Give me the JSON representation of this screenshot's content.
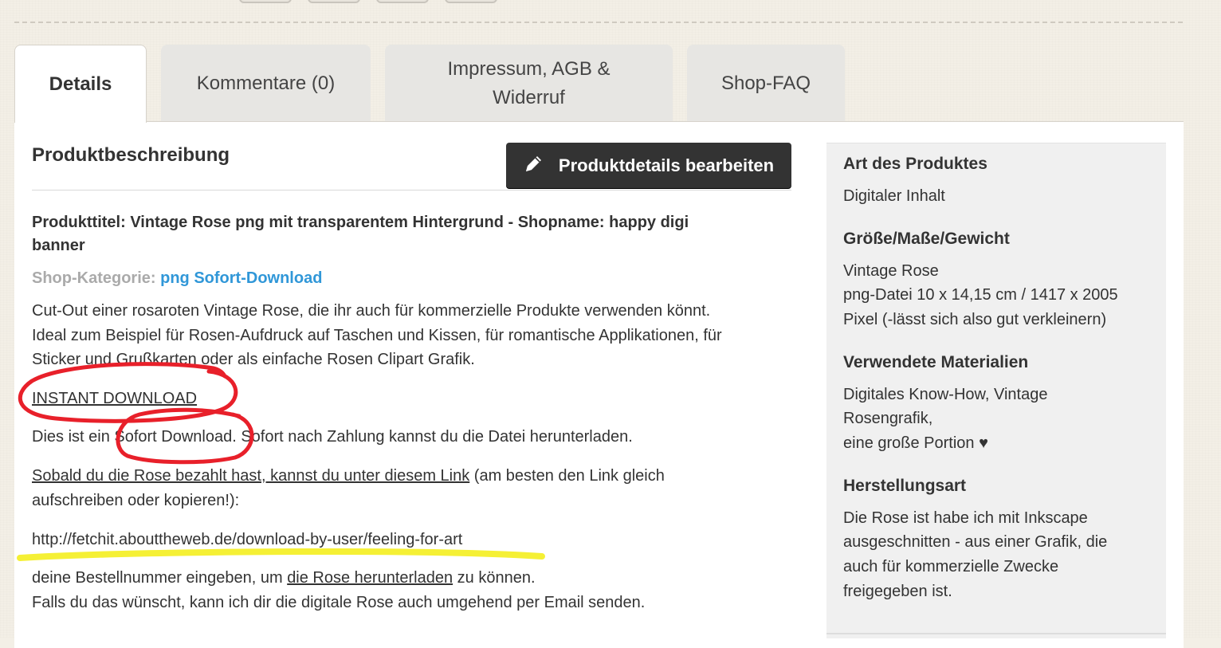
{
  "tabs": [
    {
      "label": "Details"
    },
    {
      "label": "Kommentare (0)"
    },
    {
      "label": "Impressum, AGB &",
      "label2": "Widerruf"
    },
    {
      "label": "Shop-FAQ"
    }
  ],
  "main": {
    "section_title": "Produktbeschreibung",
    "edit_button": "Produktdetails bearbeiten",
    "product_title_line1": "Produkttitel: Vintage Rose png mit transparentem Hintergrund - Shopname: happy digi",
    "product_title_line2": "banner",
    "category_label": "Shop-Kategorie:",
    "category_link": "png Sofort-Download",
    "desc_line1": "Cut-Out einer rosaroten Vintage Rose, die ihr auch für kommerzielle Produkte verwenden könnt.",
    "desc_line2": "Ideal zum Beispiel für Rosen-Aufdruck auf Taschen und Kissen, für romantische Applikationen, für",
    "desc_line3": "Sticker und Grußkarten oder als einfache Rosen Clipart Grafik.",
    "instant_download": "INSTANT DOWNLOAD",
    "sofort_line": "Dies ist ein Sofort Download. Sofort nach Zahlung kannst du die Datei herunterladen.",
    "link_line1_underlined": "Sobald du die Rose bezahlt hast, kannst du unter diesem Link",
    "link_line1_rest": " (am besten den Link gleich",
    "link_line2": "aufschreiben oder kopieren!):",
    "url": "http://fetchit.abouttheweb.de/download-by-user/feeling-for-art",
    "order_line_pre": "deine Bestellnummer eingeben, um ",
    "order_line_link": "die Rose herunterladen",
    "order_line_post": " zu können.",
    "email_line": "Falls du das wünscht, kann ich dir die digitale Rose auch umgehend per Email senden."
  },
  "sidebar": {
    "art_heading": "Art des Produktes",
    "art_value": "Digitaler Inhalt",
    "size_heading": "Größe/Maße/Gewicht",
    "size_line1": "Vintage Rose",
    "size_line2": "png-Datei 10 x 14,15 cm / 1417 x 2005",
    "size_line3": "Pixel (-lässt sich also gut verkleinern)",
    "materials_heading": "Verwendete Materialien",
    "materials_line1": "Digitales Know-How, Vintage",
    "materials_line2": "Rosengrafik,",
    "materials_line3": "eine große Portion ♥",
    "method_heading": "Herstellungsart",
    "method_line1": "Die Rose ist habe ich mit Inkscape",
    "method_line2": "ausgeschnitten - aus einer Grafik, die",
    "method_line3": "auch für kommerzielle Zwecke",
    "method_line4": "freigegeben ist."
  },
  "colors": {
    "background": "#f3efe6",
    "link_blue": "#3097d8",
    "button_dark": "#333333",
    "annotation_red": "#e8202a",
    "annotation_yellow": "#f4ef2a"
  },
  "icons": {
    "edit": "pencil-icon"
  }
}
